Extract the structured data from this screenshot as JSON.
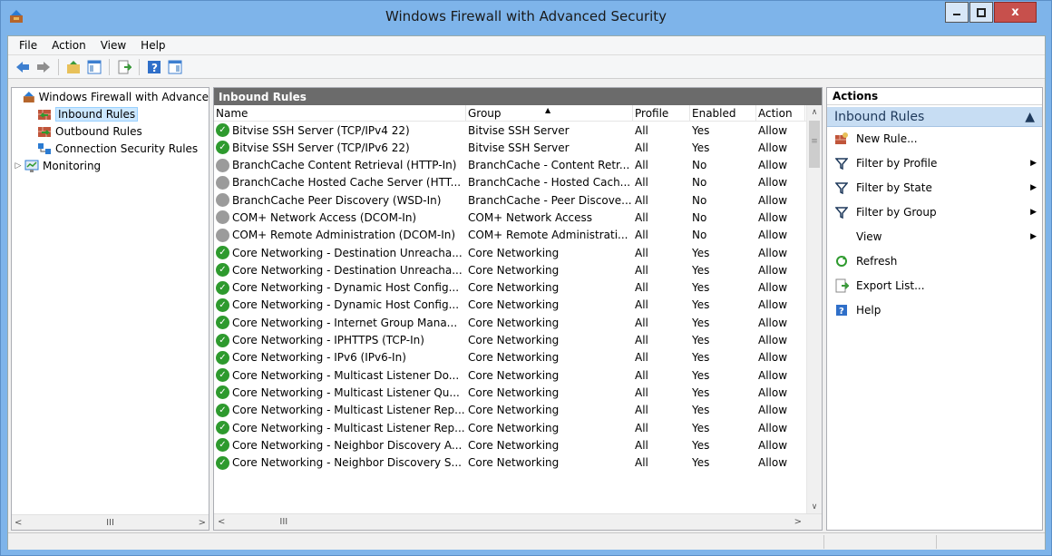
{
  "window": {
    "title": "Windows Firewall with Advanced Security",
    "minimize_icon": "minimize-icon",
    "maximize_icon": "maximize-icon",
    "close_label": "x"
  },
  "menu": {
    "items": [
      "File",
      "Action",
      "View",
      "Help"
    ]
  },
  "toolbar": {
    "icons": [
      "back-arrow-icon",
      "forward-arrow-icon",
      "up-folder-icon",
      "show-hide-console-tree-icon",
      "export-list-icon",
      "help-icon",
      "show-hide-action-pane-icon"
    ]
  },
  "tree": {
    "items": [
      {
        "label": "Windows Firewall with Advance",
        "icon": "firewall-icon",
        "selected": false,
        "indent": 0,
        "twisty": ""
      },
      {
        "label": "Inbound Rules",
        "icon": "inbound-rules-icon",
        "selected": true,
        "indent": 1,
        "twisty": ""
      },
      {
        "label": "Outbound Rules",
        "icon": "outbound-rules-icon",
        "selected": false,
        "indent": 1,
        "twisty": ""
      },
      {
        "label": "Connection Security Rules",
        "icon": "connection-security-icon",
        "selected": false,
        "indent": 1,
        "twisty": ""
      },
      {
        "label": "Monitoring",
        "icon": "monitoring-icon",
        "selected": false,
        "indent": 0,
        "twisty": "▷"
      }
    ],
    "hscroll_grip": "III"
  },
  "center": {
    "title": "Inbound Rules",
    "columns": {
      "name": "Name",
      "group": "Group",
      "profile": "Profile",
      "enabled": "Enabled",
      "action": "Action"
    },
    "rows": [
      {
        "name": "Bitvise SSH Server (TCP/IPv4 22)",
        "group": "Bitvise SSH Server",
        "profile": "All",
        "enabled": "Yes",
        "action": "Allow",
        "on": true
      },
      {
        "name": "Bitvise SSH Server (TCP/IPv6 22)",
        "group": "Bitvise SSH Server",
        "profile": "All",
        "enabled": "Yes",
        "action": "Allow",
        "on": true
      },
      {
        "name": "BranchCache Content Retrieval (HTTP-In)",
        "group": "BranchCache - Content Retr...",
        "profile": "All",
        "enabled": "No",
        "action": "Allow",
        "on": false
      },
      {
        "name": "BranchCache Hosted Cache Server (HTT...",
        "group": "BranchCache - Hosted Cach...",
        "profile": "All",
        "enabled": "No",
        "action": "Allow",
        "on": false
      },
      {
        "name": "BranchCache Peer Discovery (WSD-In)",
        "group": "BranchCache - Peer Discove...",
        "profile": "All",
        "enabled": "No",
        "action": "Allow",
        "on": false
      },
      {
        "name": "COM+ Network Access (DCOM-In)",
        "group": "COM+ Network Access",
        "profile": "All",
        "enabled": "No",
        "action": "Allow",
        "on": false
      },
      {
        "name": "COM+ Remote Administration (DCOM-In)",
        "group": "COM+ Remote Administrati...",
        "profile": "All",
        "enabled": "No",
        "action": "Allow",
        "on": false
      },
      {
        "name": "Core Networking - Destination Unreacha...",
        "group": "Core Networking",
        "profile": "All",
        "enabled": "Yes",
        "action": "Allow",
        "on": true
      },
      {
        "name": "Core Networking - Destination Unreacha...",
        "group": "Core Networking",
        "profile": "All",
        "enabled": "Yes",
        "action": "Allow",
        "on": true
      },
      {
        "name": "Core Networking - Dynamic Host Config...",
        "group": "Core Networking",
        "profile": "All",
        "enabled": "Yes",
        "action": "Allow",
        "on": true
      },
      {
        "name": "Core Networking - Dynamic Host Config...",
        "group": "Core Networking",
        "profile": "All",
        "enabled": "Yes",
        "action": "Allow",
        "on": true
      },
      {
        "name": "Core Networking - Internet Group Mana...",
        "group": "Core Networking",
        "profile": "All",
        "enabled": "Yes",
        "action": "Allow",
        "on": true
      },
      {
        "name": "Core Networking - IPHTTPS (TCP-In)",
        "group": "Core Networking",
        "profile": "All",
        "enabled": "Yes",
        "action": "Allow",
        "on": true
      },
      {
        "name": "Core Networking - IPv6 (IPv6-In)",
        "group": "Core Networking",
        "profile": "All",
        "enabled": "Yes",
        "action": "Allow",
        "on": true
      },
      {
        "name": "Core Networking - Multicast Listener Do...",
        "group": "Core Networking",
        "profile": "All",
        "enabled": "Yes",
        "action": "Allow",
        "on": true
      },
      {
        "name": "Core Networking - Multicast Listener Qu...",
        "group": "Core Networking",
        "profile": "All",
        "enabled": "Yes",
        "action": "Allow",
        "on": true
      },
      {
        "name": "Core Networking - Multicast Listener Rep...",
        "group": "Core Networking",
        "profile": "All",
        "enabled": "Yes",
        "action": "Allow",
        "on": true
      },
      {
        "name": "Core Networking - Multicast Listener Rep...",
        "group": "Core Networking",
        "profile": "All",
        "enabled": "Yes",
        "action": "Allow",
        "on": true
      },
      {
        "name": "Core Networking - Neighbor Discovery A...",
        "group": "Core Networking",
        "profile": "All",
        "enabled": "Yes",
        "action": "Allow",
        "on": true
      },
      {
        "name": "Core Networking - Neighbor Discovery S...",
        "group": "Core Networking",
        "profile": "All",
        "enabled": "Yes",
        "action": "Allow",
        "on": true
      }
    ],
    "hscroll_grip": "III"
  },
  "actions": {
    "header": "Actions",
    "section_title": "Inbound Rules",
    "items": [
      {
        "label": "New Rule...",
        "icon": "new-rule-icon",
        "submenu": false
      },
      {
        "label": "Filter by Profile",
        "icon": "filter-icon",
        "submenu": true
      },
      {
        "label": "Filter by State",
        "icon": "filter-icon",
        "submenu": true
      },
      {
        "label": "Filter by Group",
        "icon": "filter-icon",
        "submenu": true
      },
      {
        "label": "View",
        "icon": "",
        "submenu": true
      },
      {
        "label": "Refresh",
        "icon": "refresh-icon",
        "submenu": false
      },
      {
        "label": "Export List...",
        "icon": "export-list-icon",
        "submenu": false
      },
      {
        "label": "Help",
        "icon": "help-icon",
        "submenu": false
      }
    ]
  },
  "colors": {
    "titlebar": "#7eb4ea",
    "pane_header": "#6b6b6b",
    "actions_section": "#c7ddf3",
    "enabled_green": "#2e9a2e",
    "disabled_gray": "#9b9b9b",
    "close_red": "#c7504c"
  }
}
